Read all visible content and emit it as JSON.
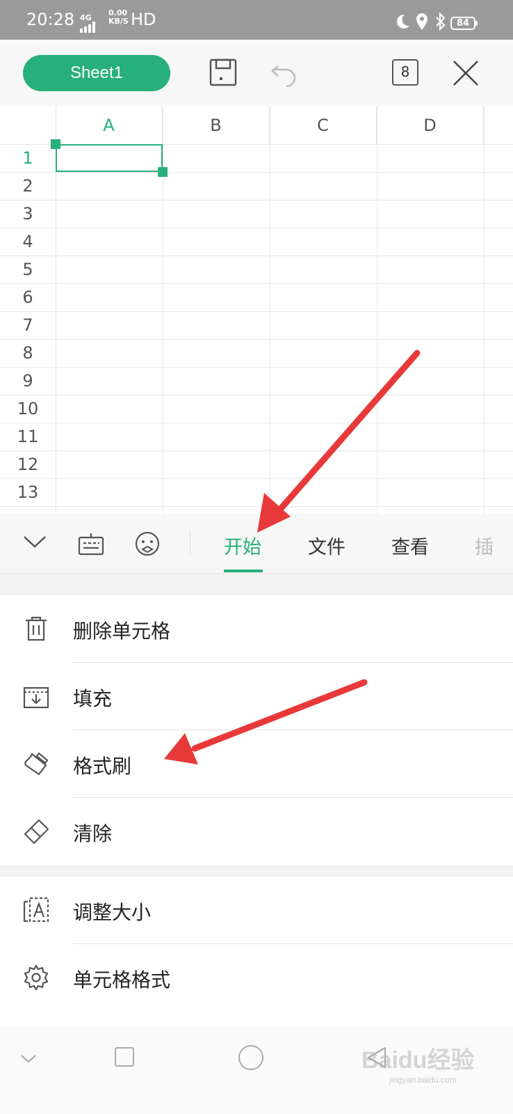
{
  "status_bar": {
    "time": "20:28",
    "network": "4G",
    "speed_value": "0.00",
    "speed_unit": "KB/S",
    "hd": "HD",
    "battery": "84"
  },
  "toolbar": {
    "sheet_name": "Sheet1",
    "tab_count": "8",
    "icons": [
      "save-icon",
      "undo-icon",
      "tabs-count-icon",
      "close-icon"
    ]
  },
  "grid": {
    "columns": [
      "A",
      "B",
      "C",
      "D"
    ],
    "rows": [
      "1",
      "2",
      "3",
      "4",
      "5",
      "6",
      "7",
      "8",
      "9",
      "10",
      "11",
      "12",
      "13"
    ],
    "selected_cell": "A1"
  },
  "tab_bar": {
    "tabs": [
      "开始",
      "文件",
      "查看",
      "插"
    ],
    "active_tab": "开始",
    "icons": [
      "collapse-icon",
      "keyboard-icon",
      "emoji-icon"
    ]
  },
  "menu": {
    "group1": [
      {
        "label": "删除单元格",
        "icon": "trash-icon"
      },
      {
        "label": "填充",
        "icon": "fill-icon"
      },
      {
        "label": "格式刷",
        "icon": "format-brush-icon"
      },
      {
        "label": "清除",
        "icon": "eraser-icon"
      }
    ],
    "group2": [
      {
        "label": "调整大小",
        "icon": "resize-icon"
      },
      {
        "label": "单元格格式",
        "icon": "gear-icon"
      }
    ]
  },
  "watermark": {
    "text": "Baidu经验",
    "sub": "jingyan.baidu.com"
  },
  "colors": {
    "accent": "#27b07a",
    "annotation_arrow": "#e8393a"
  }
}
